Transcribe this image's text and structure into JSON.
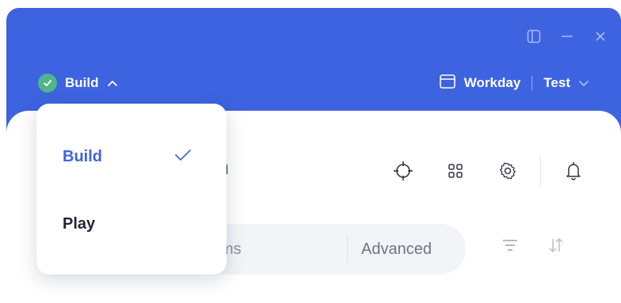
{
  "topbar": {
    "mode_label": "Build",
    "workspace_label": "Workday",
    "environment_label": "Test"
  },
  "greeting": {
    "text": "ernoon"
  },
  "search": {
    "placeholder_visible": "ms",
    "advanced_label": "Advanced"
  },
  "dropdown": {
    "items": [
      {
        "label": "Build",
        "selected": true
      },
      {
        "label": "Play",
        "selected": false
      }
    ]
  },
  "icons": {
    "window_controls": [
      "sidebar-toggle-icon",
      "minimize-icon",
      "close-icon"
    ],
    "toolbar": [
      "crosshair-icon",
      "apps-grid-icon",
      "settings-gear-icon",
      "bell-icon"
    ],
    "list": [
      "filter-icon",
      "sort-icon"
    ]
  },
  "colors": {
    "header_blue": "#3d63e0",
    "success_green": "#4fb58a",
    "text_dark": "#1f2733",
    "accent": "#3d63e0"
  }
}
